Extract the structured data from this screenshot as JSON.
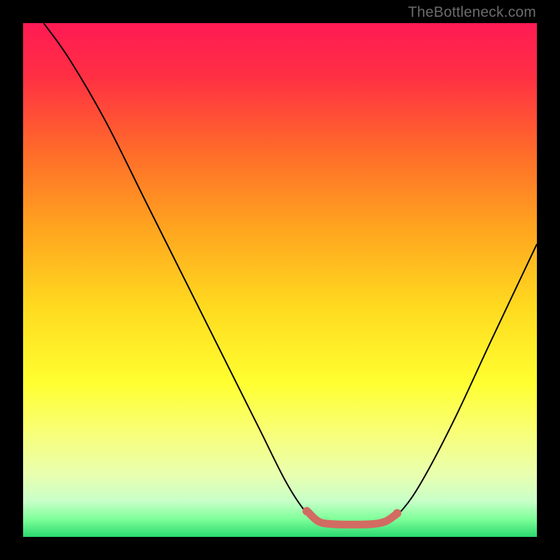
{
  "watermark": "TheBottleneck.com",
  "chart_data": {
    "type": "line",
    "title": "",
    "xlabel": "",
    "ylabel": "",
    "xlim": [
      0,
      100
    ],
    "ylim": [
      0,
      100
    ],
    "background_gradient": {
      "stops": [
        {
          "offset": 0.0,
          "color": "#ff1a54"
        },
        {
          "offset": 0.1,
          "color": "#ff2e44"
        },
        {
          "offset": 0.25,
          "color": "#ff6b2a"
        },
        {
          "offset": 0.4,
          "color": "#ffa51f"
        },
        {
          "offset": 0.55,
          "color": "#ffd91f"
        },
        {
          "offset": 0.7,
          "color": "#ffff30"
        },
        {
          "offset": 0.8,
          "color": "#f8ff7a"
        },
        {
          "offset": 0.88,
          "color": "#e8ffb0"
        },
        {
          "offset": 0.93,
          "color": "#c8ffc8"
        },
        {
          "offset": 0.965,
          "color": "#7fff9a"
        },
        {
          "offset": 1.0,
          "color": "#2bd96f"
        }
      ]
    },
    "series": [
      {
        "name": "bottleneck-curve",
        "stroke": "#000000",
        "stroke_width": 2,
        "points": [
          {
            "x": 4.0,
            "y": 100.0
          },
          {
            "x": 9.0,
            "y": 93.0
          },
          {
            "x": 16.0,
            "y": 81.0
          },
          {
            "x": 24.0,
            "y": 65.0
          },
          {
            "x": 32.0,
            "y": 49.0
          },
          {
            "x": 40.0,
            "y": 33.0
          },
          {
            "x": 46.0,
            "y": 21.0
          },
          {
            "x": 51.0,
            "y": 11.0
          },
          {
            "x": 54.5,
            "y": 5.5
          },
          {
            "x": 57.0,
            "y": 3.2
          },
          {
            "x": 60.0,
            "y": 2.5
          },
          {
            "x": 64.0,
            "y": 2.4
          },
          {
            "x": 68.0,
            "y": 2.5
          },
          {
            "x": 71.0,
            "y": 3.2
          },
          {
            "x": 74.0,
            "y": 5.5
          },
          {
            "x": 78.0,
            "y": 11.5
          },
          {
            "x": 84.0,
            "y": 23.0
          },
          {
            "x": 91.0,
            "y": 38.0
          },
          {
            "x": 100.0,
            "y": 57.0
          }
        ]
      },
      {
        "name": "highlight-segment",
        "stroke": "#d26b62",
        "stroke_width": 11,
        "linecap": "round",
        "points": [
          {
            "x": 55.5,
            "y": 4.8
          },
          {
            "x": 57.5,
            "y": 3.0
          },
          {
            "x": 60.0,
            "y": 2.5
          },
          {
            "x": 64.0,
            "y": 2.4
          },
          {
            "x": 68.0,
            "y": 2.5
          },
          {
            "x": 70.5,
            "y": 3.0
          },
          {
            "x": 72.5,
            "y": 4.3
          }
        ]
      }
    ],
    "highlight_dots": {
      "fill": "#d26b62",
      "r": 6,
      "points": [
        {
          "x": 55.2,
          "y": 5.0
        },
        {
          "x": 72.8,
          "y": 4.6
        }
      ]
    }
  }
}
